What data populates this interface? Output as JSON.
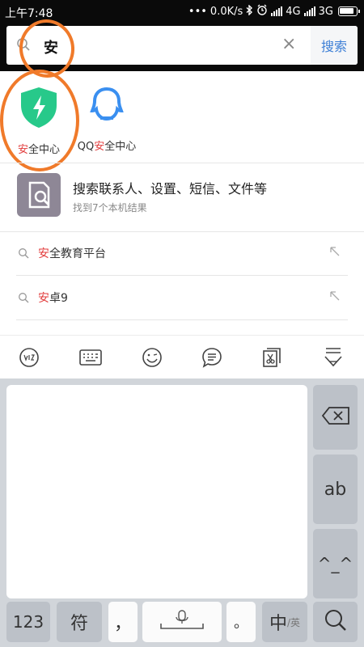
{
  "status_bar": {
    "time": "上午7:48",
    "dots": "•••",
    "speed": "0.0K/s",
    "network1": "4G",
    "network2": "3G"
  },
  "search": {
    "query": "安",
    "clear_icon": "close-icon",
    "submit_label": "搜索"
  },
  "apps": [
    {
      "label_highlight": "安",
      "label_rest": "全中心",
      "icon": "shield-lightning-icon",
      "color": "#27c98a"
    },
    {
      "label_prefix": "QQ",
      "label_highlight": "安",
      "label_rest": "全中心",
      "icon": "qq-penguin-shield-icon",
      "color": "#3a8ff0"
    }
  ],
  "local_search": {
    "title": "搜索联系人、设置、短信、文件等",
    "subtitle": "找到7个本机结果"
  },
  "suggestions": [
    {
      "highlight": "安",
      "rest": "全教育平台"
    },
    {
      "highlight": "安",
      "rest": "卓9"
    }
  ],
  "keyboard": {
    "key_numbers": "123",
    "key_symbols": "符",
    "key_comma": "，",
    "key_period": "。",
    "key_lang_main": "中",
    "key_lang_alt": "/英",
    "key_letters": "ab",
    "key_emoticon": "^_^"
  },
  "colors": {
    "highlight": "#e23b3b",
    "annotation": "#f07a2a",
    "search_button_text": "#3d7fd6"
  }
}
